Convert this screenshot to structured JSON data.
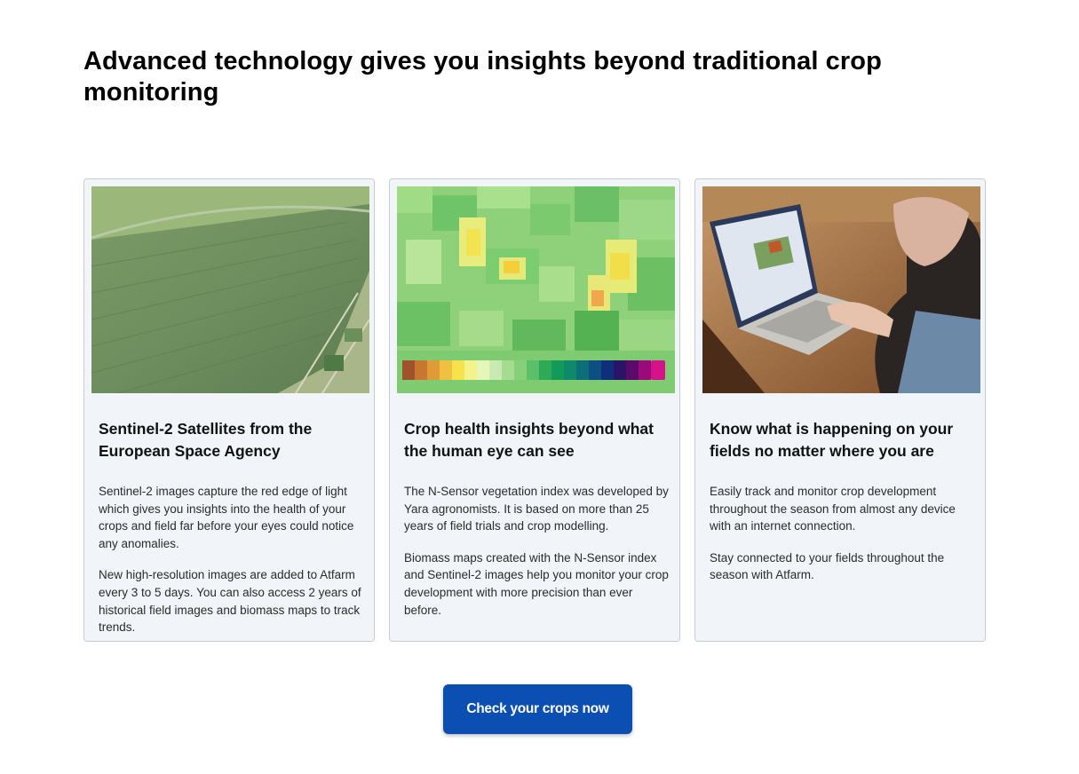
{
  "headline": "Advanced technology gives you insights beyond traditional crop monitoring",
  "cards": [
    {
      "image": "aerial-crop-field-photo",
      "title": "Sentinel-2 Satellites from the European Space Agency",
      "paragraphs": [
        "Sentinel-2 images capture the red edge of light which gives you insights into the health of your crops and field far before your eyes could notice any anomalies.",
        "New high-resolution images are added to Atfarm every 3 to 5 days. You can also access 2 years of historical field images and biomass maps to track trends."
      ]
    },
    {
      "image": "biomass-heatmap-with-color-scale",
      "title": "Crop health insights beyond what the human eye can see",
      "paragraphs": [
        "The N-Sensor vegetation index was developed by Yara agronomists. It is based on more than 25 years of field trials and crop modelling.",
        "Biomass maps created with the N-Sensor index and Sentinel-2 images help you monitor your crop development with more precision than ever before."
      ]
    },
    {
      "image": "person-using-laptop-photo",
      "title": "Know what is happening on your fields no matter where you are",
      "paragraphs": [
        "Easily track and monitor crop development throughout the season from almost any device with an internet connection.",
        "Stay connected to your fields throughout the season with Atfarm."
      ]
    }
  ],
  "cta": {
    "label": "Check your crops now",
    "color": "#0b4fb3"
  }
}
